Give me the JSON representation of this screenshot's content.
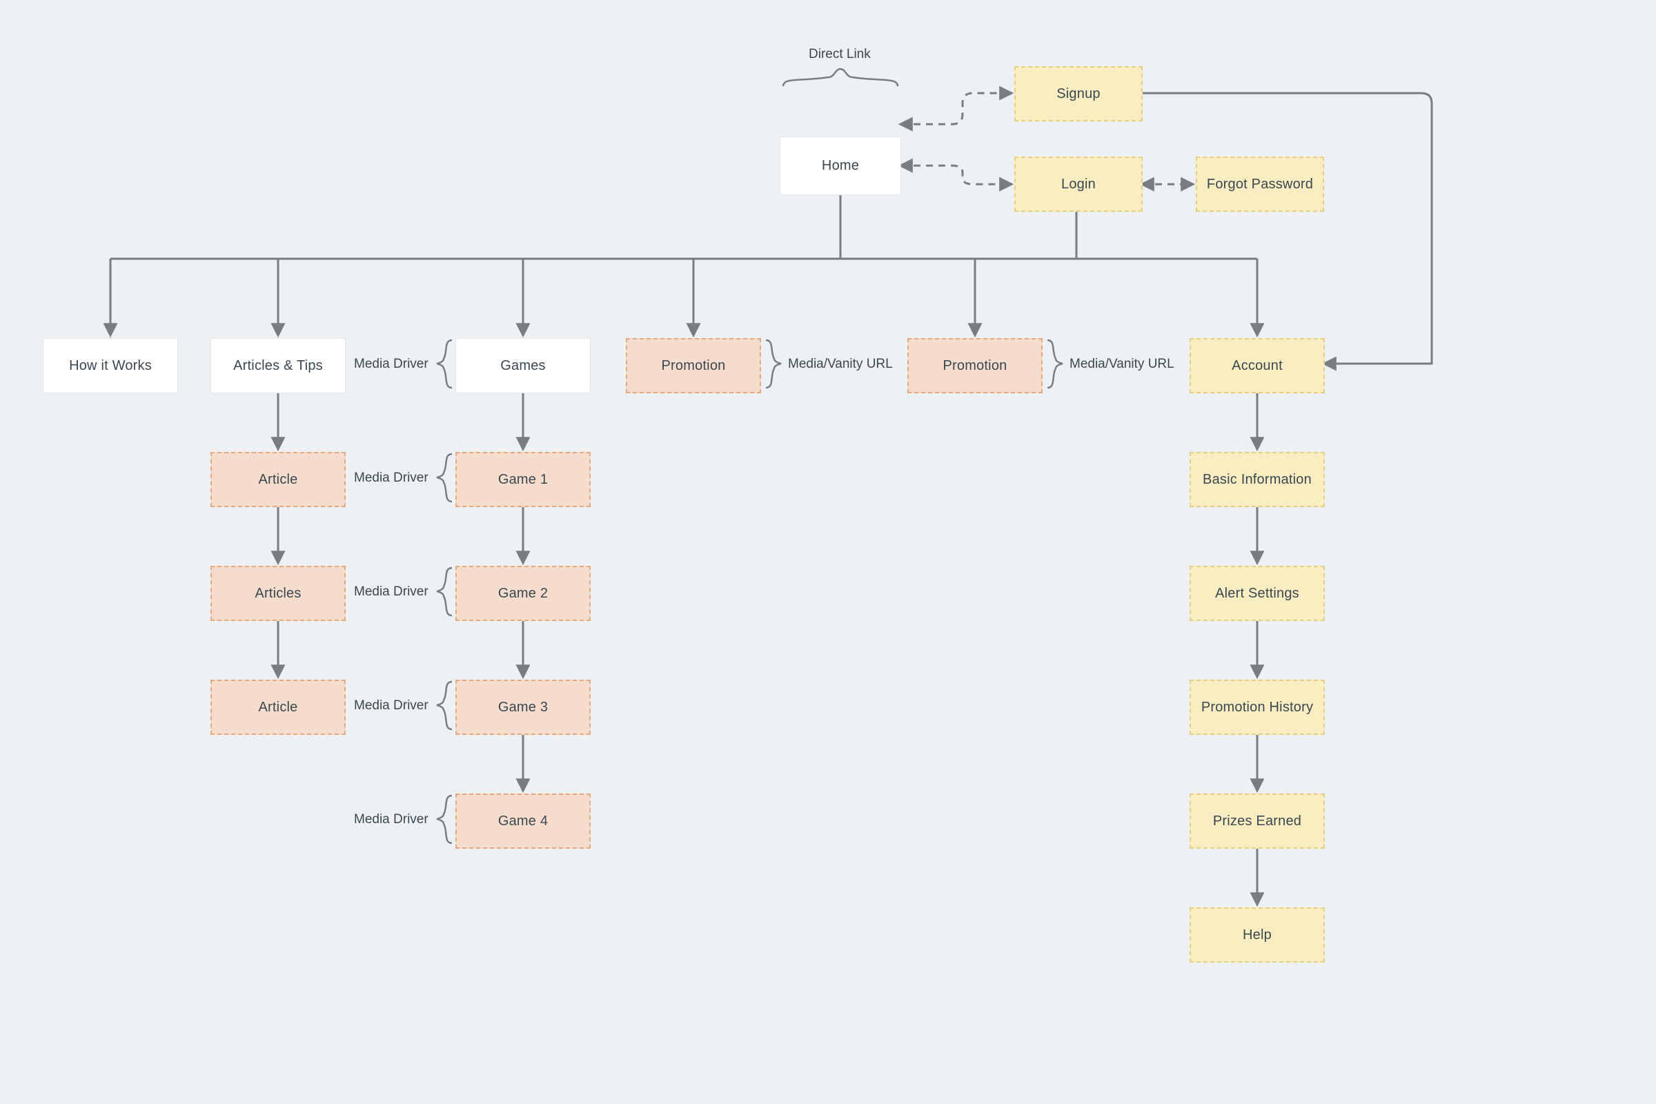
{
  "annotations": {
    "direct_link": "Direct Link",
    "media_driver": "Media Driver",
    "media_vanity_url": "Media/Vanity URL"
  },
  "nodes": {
    "home": "Home",
    "signup": "Signup",
    "login": "Login",
    "forgot_password": "Forgot Password",
    "how_it_works": "How it Works",
    "articles_tips": "Articles & Tips",
    "games": "Games",
    "promotion": "Promotion",
    "account": "Account",
    "article": "Article",
    "articles": "Articles",
    "game1": "Game 1",
    "game2": "Game 2",
    "game3": "Game 3",
    "game4": "Game 4",
    "basic_information": "Basic Information",
    "alert_settings": "Alert Settings",
    "promotion_history": "Promotion History",
    "prizes_earned": "Prizes Earned",
    "help": "Help"
  },
  "colors": {
    "line": "#777d82",
    "bg": "#eef1f3",
    "white_fill": "#ffffff",
    "orange_fill": "#f6dccc",
    "orange_border": "#e4a97e",
    "yellow_fill": "#faedc1",
    "yellow_border": "#e7cf82"
  }
}
